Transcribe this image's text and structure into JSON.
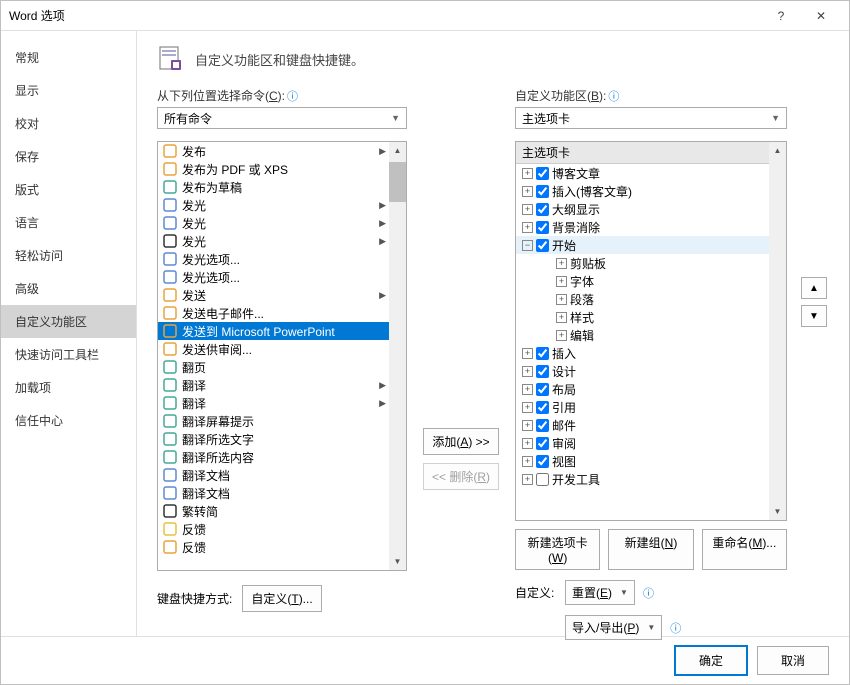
{
  "window": {
    "title": "Word 选项",
    "help": "?",
    "close": "✕"
  },
  "sidebar": {
    "items": [
      {
        "label": "常规"
      },
      {
        "label": "显示"
      },
      {
        "label": "校对"
      },
      {
        "label": "保存"
      },
      {
        "label": "版式"
      },
      {
        "label": "语言"
      },
      {
        "label": "轻松访问"
      },
      {
        "label": "高级"
      },
      {
        "label": "自定义功能区",
        "active": true
      },
      {
        "label": "快速访问工具栏"
      },
      {
        "label": "加载项"
      },
      {
        "label": "信任中心"
      }
    ]
  },
  "header": {
    "text": "自定义功能区和键盘快捷键。"
  },
  "left": {
    "label_pre": "从下列位置选择命令(",
    "label_u": "C",
    "label_post": "):",
    "dropdown": "所有命令",
    "commands": [
      {
        "label": "发布",
        "sub": true
      },
      {
        "label": "发布为 PDF 或 XPS"
      },
      {
        "label": "发布为草稿"
      },
      {
        "label": "发光",
        "sub": true
      },
      {
        "label": "发光",
        "sub": true
      },
      {
        "label": "发光",
        "sub": true
      },
      {
        "label": "发光选项..."
      },
      {
        "label": "发光选项..."
      },
      {
        "label": "发送",
        "sub": true
      },
      {
        "label": "发送电子邮件..."
      },
      {
        "label": "发送到 Microsoft PowerPoint",
        "selected": true
      },
      {
        "label": "发送供审阅..."
      },
      {
        "label": "翻页"
      },
      {
        "label": "翻译",
        "sub": true
      },
      {
        "label": "翻译",
        "sub": true
      },
      {
        "label": "翻译屏幕提示"
      },
      {
        "label": "翻译所选文字"
      },
      {
        "label": "翻译所选内容"
      },
      {
        "label": "翻译文档"
      },
      {
        "label": "翻译文档"
      },
      {
        "label": "繁转简"
      },
      {
        "label": "反馈"
      },
      {
        "label": "反馈"
      }
    ],
    "kb_label": "键盘快捷方式:",
    "kb_btn_pre": "自定义(",
    "kb_btn_u": "T",
    "kb_btn_post": ")..."
  },
  "mid": {
    "add_pre": "添加(",
    "add_u": "A",
    "add_post": ") >>",
    "remove_pre": "<< 删除(",
    "remove_u": "R",
    "remove_post": ")"
  },
  "right": {
    "label_pre": "自定义功能区(",
    "label_u": "B",
    "label_post": "):",
    "dropdown": "主选项卡",
    "tree_header": "主选项卡",
    "nodes": [
      {
        "exp": "+",
        "chk": true,
        "label": "博客文章",
        "l": 1
      },
      {
        "exp": "+",
        "chk": true,
        "label": "插入(博客文章)",
        "l": 1
      },
      {
        "exp": "+",
        "chk": true,
        "label": "大纲显示",
        "l": 1
      },
      {
        "exp": "+",
        "chk": true,
        "label": "背景消除",
        "l": 1
      },
      {
        "exp": "−",
        "chk": true,
        "label": "开始",
        "l": 1,
        "hl": true
      },
      {
        "exp": "+",
        "label": "剪贴板",
        "l": 2
      },
      {
        "exp": "+",
        "label": "字体",
        "l": 2
      },
      {
        "exp": "+",
        "label": "段落",
        "l": 2
      },
      {
        "exp": "+",
        "label": "样式",
        "l": 2
      },
      {
        "exp": "+",
        "label": "编辑",
        "l": 2
      },
      {
        "exp": "+",
        "chk": true,
        "label": "插入",
        "l": 1
      },
      {
        "exp": "+",
        "chk": true,
        "label": "设计",
        "l": 1
      },
      {
        "exp": "+",
        "chk": true,
        "label": "布局",
        "l": 1
      },
      {
        "exp": "+",
        "chk": true,
        "label": "引用",
        "l": 1
      },
      {
        "exp": "+",
        "chk": true,
        "label": "邮件",
        "l": 1
      },
      {
        "exp": "+",
        "chk": true,
        "label": "审阅",
        "l": 1
      },
      {
        "exp": "+",
        "chk": true,
        "label": "视图",
        "l": 1
      },
      {
        "exp": "+",
        "chk": false,
        "label": "开发工具",
        "l": 1
      }
    ],
    "newtab_pre": "新建选项卡(",
    "newtab_u": "W",
    "newtab_post": ")",
    "newgrp_pre": "新建组(",
    "newgrp_u": "N",
    "newgrp_post": ")",
    "rename_pre": "重命名(",
    "rename_u": "M",
    "rename_post": ")...",
    "custom_label": "自定义:",
    "reset_pre": "重置(",
    "reset_u": "E",
    "reset_post": ")",
    "impexp_pre": "导入/导出(",
    "impexp_u": "P",
    "impexp_post": ")"
  },
  "footer": {
    "ok": "确定",
    "cancel": "取消"
  },
  "icons": {
    "cmd_colors": [
      "#e8a33d",
      "#e8a33d",
      "#4a9",
      "#5b8bd4",
      "#5b8bd4",
      "#333",
      "#5b8bd4",
      "#5b8bd4",
      "#e8a33d",
      "#e8a33d",
      "#e8a33d",
      "#e8a33d",
      "#4a9",
      "#4a9",
      "#4a9",
      "#4a9",
      "#4a9",
      "#4a9",
      "#5b8bd4",
      "#5b8bd4",
      "#333",
      "#e8c23d",
      "#e8a33d"
    ]
  }
}
